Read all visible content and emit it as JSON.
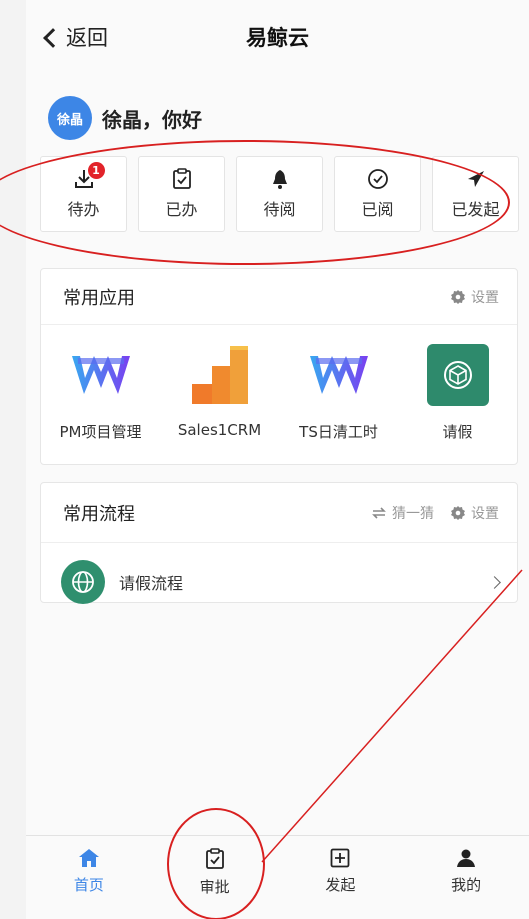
{
  "header": {
    "back_label": "返回",
    "title": "易鲸云"
  },
  "user": {
    "avatar_text": "徐晶",
    "greeting": "徐晶，你好"
  },
  "quick_tiles": [
    {
      "label": "待办",
      "icon": "download-icon",
      "badge": "1"
    },
    {
      "label": "已办",
      "icon": "clipboard-check-icon"
    },
    {
      "label": "待阅",
      "icon": "bell-icon"
    },
    {
      "label": "已阅",
      "icon": "check-circle-icon"
    },
    {
      "label": "已发起",
      "icon": "send-icon"
    }
  ],
  "common_apps": {
    "title": "常用应用",
    "settings_label": "设置",
    "items": [
      {
        "label": "PM项目管理",
        "icon": "ts-logo-icon"
      },
      {
        "label": "Sales1CRM",
        "icon": "bar-chart-logo-icon"
      },
      {
        "label": "TS日清工时",
        "icon": "ts-logo-icon"
      },
      {
        "label": "请假",
        "icon": "cube-icon"
      }
    ]
  },
  "common_flows": {
    "title": "常用流程",
    "guess_label": "猜一猜",
    "settings_label": "设置",
    "items": [
      {
        "label": "请假流程",
        "icon": "globe-icon"
      }
    ]
  },
  "tabbar": {
    "items": [
      {
        "label": "首页",
        "icon": "home-icon",
        "active": true
      },
      {
        "label": "审批",
        "icon": "clipboard-check-icon",
        "active": false
      },
      {
        "label": "发起",
        "icon": "plus-square-icon",
        "active": false
      },
      {
        "label": "我的",
        "icon": "person-icon",
        "active": false
      }
    ]
  },
  "colors": {
    "accent": "#3d86e6",
    "annotation": "#d82020",
    "badge": "#e2232a",
    "flow_icon": "#2f8f6e",
    "leave_icon": "#2e8a6c"
  }
}
